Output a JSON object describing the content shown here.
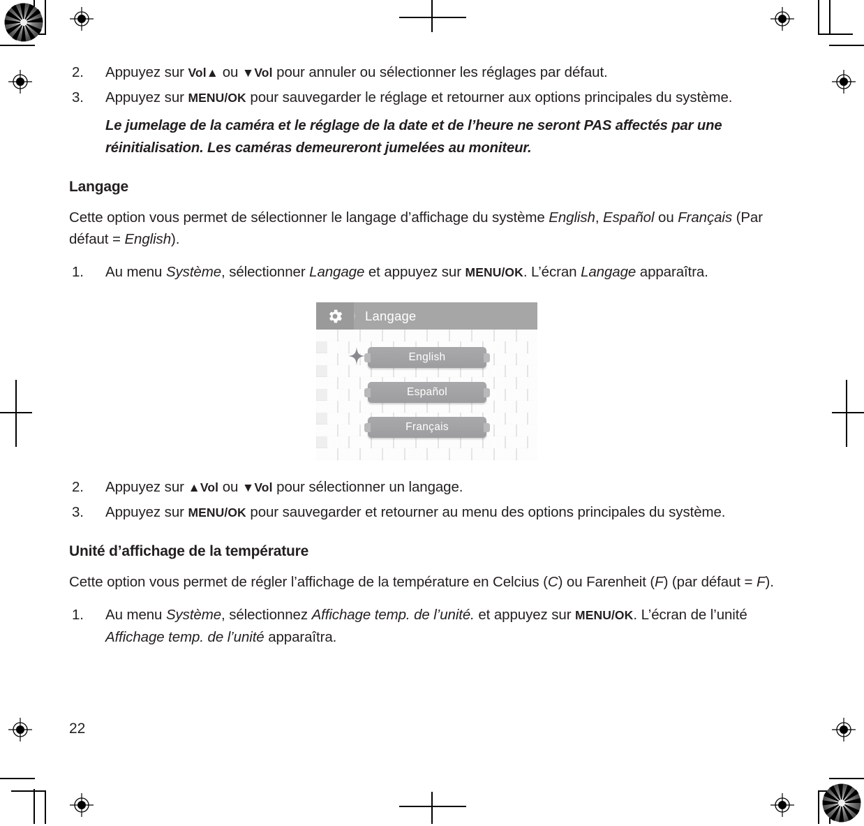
{
  "document": {
    "page_number": "22",
    "language": "fr"
  },
  "sections": [
    {
      "type": "step",
      "name": "step-reset-2",
      "number": "2.",
      "runs": [
        {
          "t": "Appuyez sur ",
          "s": "normal"
        },
        {
          "t": "Vol▲",
          "s": "kbd"
        },
        {
          "t": " ou ",
          "s": "normal"
        },
        {
          "t": "▼Vol",
          "s": "kbd"
        },
        {
          "t": " pour annuler ou sélectionner les réglages par défaut.",
          "s": "normal"
        }
      ]
    },
    {
      "type": "step",
      "name": "step-reset-3",
      "number": "3.",
      "runs": [
        {
          "t": "Appuyez sur ",
          "s": "normal"
        },
        {
          "t": "MENU/OK",
          "s": "kbd"
        },
        {
          "t": " pour sauvegarder le réglage et retourner aux options principales du système.",
          "s": "normal"
        }
      ]
    }
  ],
  "note": "Le jumelage de la caméra et le réglage de la date et de l’heure ne seront PAS affectés par une réinitialisation. Les caméras demeureront jumelées au moniteur.",
  "langage_section": {
    "heading": "Langage",
    "intro_runs": [
      {
        "t": "Cette option vous permet de sélectionner le langage d’affichage du système ",
        "s": "normal"
      },
      {
        "t": "English",
        "s": "ital"
      },
      {
        "t": ", ",
        "s": "normal"
      },
      {
        "t": "Español",
        "s": "ital"
      },
      {
        "t": " ou ",
        "s": "normal"
      },
      {
        "t": "Français",
        "s": "ital"
      },
      {
        "t": " (Par défaut = ",
        "s": "normal"
      },
      {
        "t": "English",
        "s": "ital"
      },
      {
        "t": ").",
        "s": "normal"
      }
    ],
    "step1": {
      "number": "1.",
      "runs": [
        {
          "t": "Au menu ",
          "s": "normal"
        },
        {
          "t": "Système",
          "s": "ital"
        },
        {
          "t": ", sélectionner ",
          "s": "normal"
        },
        {
          "t": "Langage",
          "s": "ital"
        },
        {
          "t": " et appuyez sur ",
          "s": "normal"
        },
        {
          "t": "MENU/OK",
          "s": "kbd"
        },
        {
          "t": ". L’écran ",
          "s": "normal"
        },
        {
          "t": "Langage",
          "s": "ital"
        },
        {
          "t": " apparaîtra.",
          "s": "normal"
        }
      ]
    },
    "step2": {
      "number": "2.",
      "runs": [
        {
          "t": "Appuyez sur ",
          "s": "normal"
        },
        {
          "t": "▲Vol",
          "s": "kbd"
        },
        {
          "t": " ou ",
          "s": "normal"
        },
        {
          "t": "▼Vol",
          "s": "kbd"
        },
        {
          "t": " pour sélectionner un langage.",
          "s": "normal"
        }
      ]
    },
    "step3": {
      "number": "3.",
      "runs": [
        {
          "t": "Appuyez sur ",
          "s": "normal"
        },
        {
          "t": "MENU/OK",
          "s": "kbd"
        },
        {
          "t": " pour sauvegarder et retourner au menu des options principales du système.",
          "s": "normal"
        }
      ]
    }
  },
  "temperature_section": {
    "heading": "Unité d’affichage de la température",
    "intro_runs": [
      {
        "t": "Cette option vous permet de régler l’affichage de la température en Celcius (",
        "s": "normal"
      },
      {
        "t": "C",
        "s": "ital"
      },
      {
        "t": ") ou Farenheit (",
        "s": "normal"
      },
      {
        "t": "F",
        "s": "ital"
      },
      {
        "t": ") (par défaut = ",
        "s": "normal"
      },
      {
        "t": "F",
        "s": "ital"
      },
      {
        "t": ").",
        "s": "normal"
      }
    ],
    "step1": {
      "number": "1.",
      "runs": [
        {
          "t": "Au menu ",
          "s": "normal"
        },
        {
          "t": "Système",
          "s": "ital"
        },
        {
          "t": ", sélectionnez ",
          "s": "normal"
        },
        {
          "t": "Affichage temp. de l’unité.",
          "s": "ital"
        },
        {
          "t": " et appuyez sur ",
          "s": "normal"
        },
        {
          "t": "MENU/OK",
          "s": "kbd"
        },
        {
          "t": ". L’écran de l’unité ",
          "s": "normal"
        },
        {
          "t": "Affichage temp. de l’unité",
          "s": "ital"
        },
        {
          "t": " apparaîtra.",
          "s": "normal"
        }
      ]
    }
  },
  "device_screenshot": {
    "name": "langage-menu-screen",
    "header_title": "Langage",
    "header_icon": "gear-icon",
    "cursor_icon": "four-point-star-cursor",
    "selected_index": 0,
    "menu_items": [
      {
        "label": "English"
      },
      {
        "label": "Español"
      },
      {
        "label": "Français"
      }
    ],
    "colors": {
      "header_bg": "#a6a6a6",
      "icon_bg": "#9a9a9a",
      "item_bg": "#a4a4a7",
      "screen_bg": "#efeff0",
      "text": "#ffffff"
    }
  },
  "print_marks": {
    "registration_icon": "registration-target-icon",
    "starburst_icon": "print-starburst-icon",
    "crop_icon": "crop-mark"
  }
}
